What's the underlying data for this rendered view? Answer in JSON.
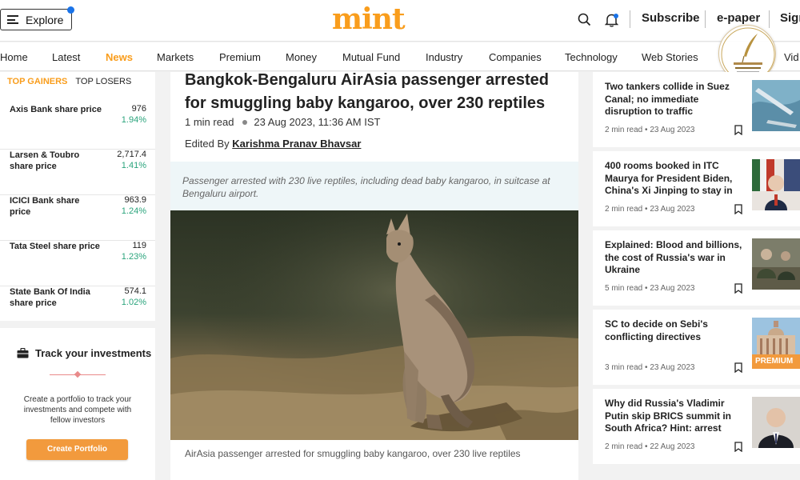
{
  "header": {
    "explore_label": "Explore",
    "logo": "mint",
    "subscribe_label": "Subscribe",
    "epaper_label": "e-paper",
    "signin_label": "Sign"
  },
  "nav": {
    "items": [
      "Home",
      "Latest",
      "News",
      "Markets",
      "Premium",
      "Money",
      "Mutual Fund",
      "Industry",
      "Companies",
      "Technology",
      "Web Stories",
      "Vid"
    ],
    "active": "News"
  },
  "watermark": {
    "text_main": "สำนักข่าวอิศรา",
    "text_sub": "ISRA NEWS AGENCY"
  },
  "market": {
    "tab_active": "TOP GAINERS",
    "tab_other": "TOP LOSERS",
    "stocks": [
      {
        "name": "Axis Bank share price",
        "price": "976",
        "change": "1.94%"
      },
      {
        "name": "Larsen & Toubro share price",
        "price": "2,717.4",
        "change": "1.41%"
      },
      {
        "name": "ICICI Bank share price",
        "price": "963.9",
        "change": "1.24%"
      },
      {
        "name": "Tata Steel share price",
        "price": "119",
        "change": "1.23%"
      },
      {
        "name": "State Bank Of India share price",
        "price": "574.1",
        "change": "1.02%"
      }
    ]
  },
  "track": {
    "title": "Track your investments",
    "description": "Create a portfolio to track your investments and compete with fellow investors",
    "button": "Create Portfolio"
  },
  "article": {
    "headline": "Bangkok-Bengaluru AirAsia passenger arrested for smuggling baby kangaroo, over 230 reptiles",
    "read_time": "1 min read",
    "datetime": "23 Aug 2023, 11:36 AM IST",
    "edited_prefix": "Edited By",
    "editor": "Karishma Pranav Bhavsar",
    "summary": "Passenger arrested with 230 live reptiles, including dead baby kangaroo, in suitcase at Bengaluru airport.",
    "caption": "AirAsia passenger arrested for smuggling baby kangaroo, over 230 live reptiles"
  },
  "stories": [
    {
      "title": "Two tankers collide in Suez Canal; no immediate disruption to traffic",
      "read": "2 min read",
      "date": "23 Aug 2023",
      "premium": false
    },
    {
      "title": "400 rooms booked in ITC Maurya for President Biden, China's Xi Jinping to stay in",
      "read": "2 min read",
      "date": "23 Aug 2023",
      "premium": false
    },
    {
      "title": "Explained: Blood and billions, the cost of Russia's war in Ukraine",
      "read": "5 min read",
      "date": "23 Aug 2023",
      "premium": false
    },
    {
      "title": "SC to decide on Sebi's conflicting directives",
      "read": "3 min read",
      "date": "23 Aug 2023",
      "premium": true,
      "premium_label": "PREMIUM"
    },
    {
      "title": "Why did Russia's Vladimir Putin skip BRICS summit in South Africa? Hint: arrest",
      "read": "2 min read",
      "date": "22 Aug 2023",
      "premium": false
    }
  ],
  "colors": {
    "brand": "#f99d1c",
    "gain": "#2aa47c",
    "accent_blue": "#1a73e8",
    "button": "#f29a3d"
  },
  "icons": [
    "hamburger-icon",
    "search-icon",
    "bell-icon",
    "briefcase-icon",
    "bookmark-icon"
  ]
}
